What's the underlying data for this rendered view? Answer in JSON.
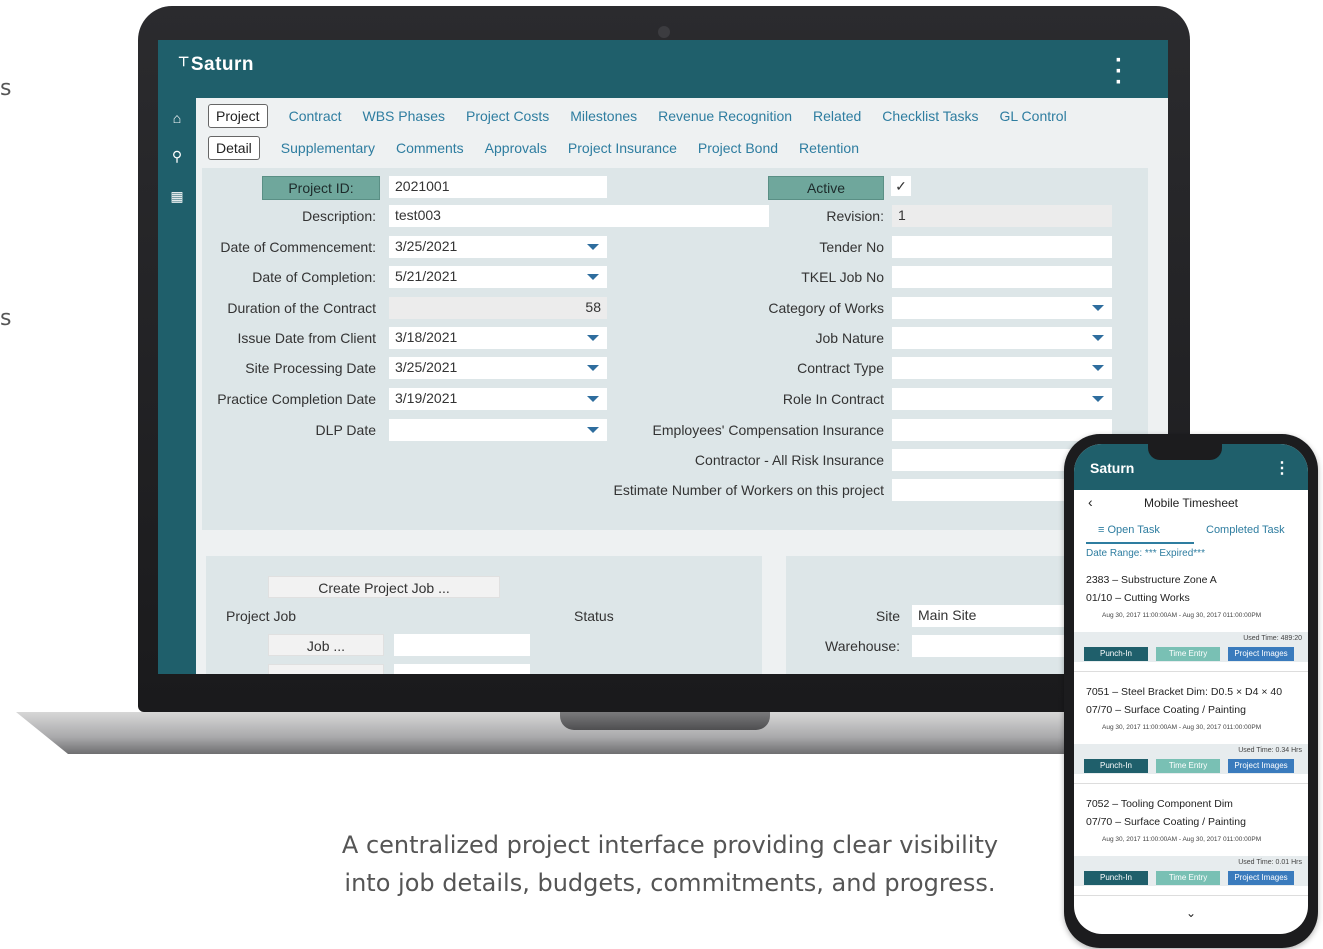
{
  "colors": {
    "brand_teal": "#1f5f6b",
    "link_blue": "#2e7da0",
    "label_highlight": "#6fa79c"
  },
  "edge_glyphs": [
    "s",
    "s"
  ],
  "app": {
    "brand": "Saturn",
    "menu_icon": "kebab-menu-icon",
    "sidebar_icons": [
      "home-icon",
      "search-icon",
      "grid-icon"
    ],
    "tabs_primary": [
      "Project",
      "Contract",
      "WBS Phases",
      "Project Costs",
      "Milestones",
      "Revenue Recognition",
      "Related",
      "Checklist Tasks",
      "GL Control"
    ],
    "tabs_secondary": [
      "Detail",
      "Supplementary",
      "Comments",
      "Approvals",
      "Project Insurance",
      "Project Bond",
      "Retention"
    ],
    "form_left": [
      {
        "label": "Project ID:",
        "value": "2021001"
      },
      {
        "label": "Description:",
        "value": "test003"
      },
      {
        "label": "Date of Commencement:",
        "value": "3/25/2021"
      },
      {
        "label": "Date of Completion:",
        "value": "5/21/2021"
      },
      {
        "label": "Duration of the Contract",
        "value": "58"
      },
      {
        "label": "Issue Date from Client",
        "value": "3/18/2021"
      },
      {
        "label": "Site Processing Date",
        "value": "3/25/2021"
      },
      {
        "label": "Practice Completion Date",
        "value": "3/19/2021"
      },
      {
        "label": "DLP Date",
        "value": ""
      }
    ],
    "form_right": [
      {
        "label": "Active",
        "value": "✓"
      },
      {
        "label": "Revision:",
        "value": "1"
      },
      {
        "label": "Tender No",
        "value": ""
      },
      {
        "label": "TKEL Job No",
        "value": ""
      },
      {
        "label": "Category of Works",
        "value": ""
      },
      {
        "label": "Job Nature",
        "value": ""
      },
      {
        "label": "Contract Type",
        "value": ""
      },
      {
        "label": "Role In Contract",
        "value": ""
      },
      {
        "label": "Employees' Compensation Insurance",
        "value": ""
      },
      {
        "label": "Contractor - All Risk Insurance",
        "value": ""
      },
      {
        "label": "Estimate Number of Workers on this project",
        "value": ""
      }
    ],
    "lower": {
      "create_job_button": "Create Project Job ...",
      "project_job_label": "Project Job",
      "status_label": "Status",
      "job_button": "Job ...",
      "site_label": "Site",
      "site_value": "Main Site",
      "warehouse_label": "Warehouse:"
    }
  },
  "mobile": {
    "brand": "Saturn",
    "title": "Mobile Timesheet",
    "tab_open": "≡ Open Task",
    "tab_completed": "Completed Task",
    "date_range": "Date Range: *** Expired***",
    "cards": [
      {
        "line1": "2383 – Substructure Zone A",
        "line2": "01/10 – Cutting Works",
        "dates": "Aug 30, 2017 11:00:00AM - Aug 30, 2017 011:00:00PM",
        "used": "Used Time: 489:20"
      },
      {
        "line1": "7051 – Steel Bracket Dim: D0.5 × D4 × 40",
        "line2": "07/70 – Surface Coating / Painting",
        "dates": "Aug 30, 2017 11:00:00AM - Aug 30, 2017 011:00:00PM",
        "used": "Used Time: 0.34 Hrs"
      },
      {
        "line1": "7052 – Tooling Component Dim",
        "line2": "07/70 – Surface Coating / Painting",
        "dates": "Aug 30, 2017 11:00:00AM - Aug 30, 2017 011:00:00PM",
        "used": "Used Time: 0.01 Hrs"
      }
    ],
    "buttons": {
      "punch": "Punch-In",
      "time": "Time Entry",
      "images": "Project Images"
    }
  },
  "caption": {
    "line1": "A centralized project interface providing clear visibility",
    "line2": "into job details, budgets, commitments, and progress."
  }
}
